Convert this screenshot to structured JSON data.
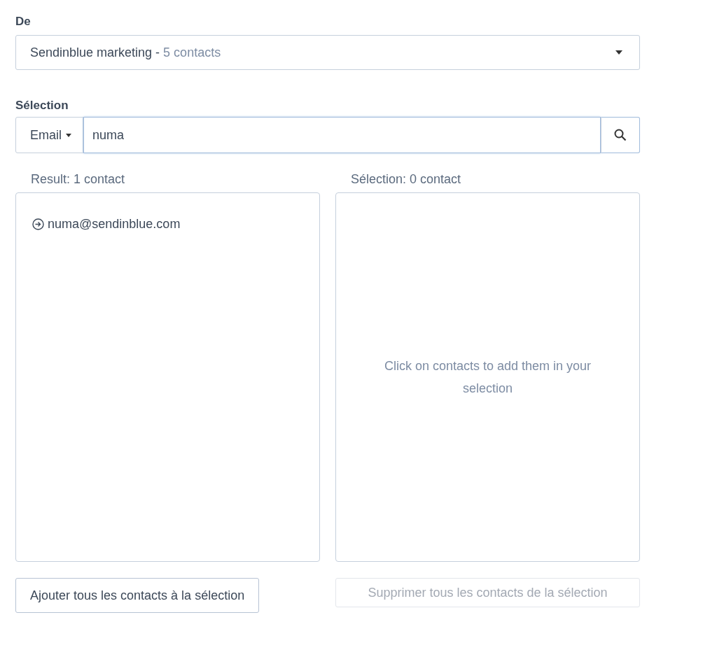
{
  "source": {
    "label": "De",
    "value": "Sendinblue marketing - ",
    "count": "5 contacts"
  },
  "selection": {
    "label": "Sélection",
    "field_menu": "Email",
    "query": "numa"
  },
  "result": {
    "title": "Result: 1 contact",
    "items": [
      {
        "email": "numa@sendinblue.com"
      }
    ]
  },
  "selected": {
    "title": "Sélection: 0 contact",
    "empty_hint": "Click on contacts to add them in your selection"
  },
  "buttons": [
    {
      "label": "Ajouter tous les contacts à la sélection",
      "disabled": false
    },
    {
      "label": "Supprimer tous les contacts de la sélection",
      "disabled": true
    }
  ]
}
